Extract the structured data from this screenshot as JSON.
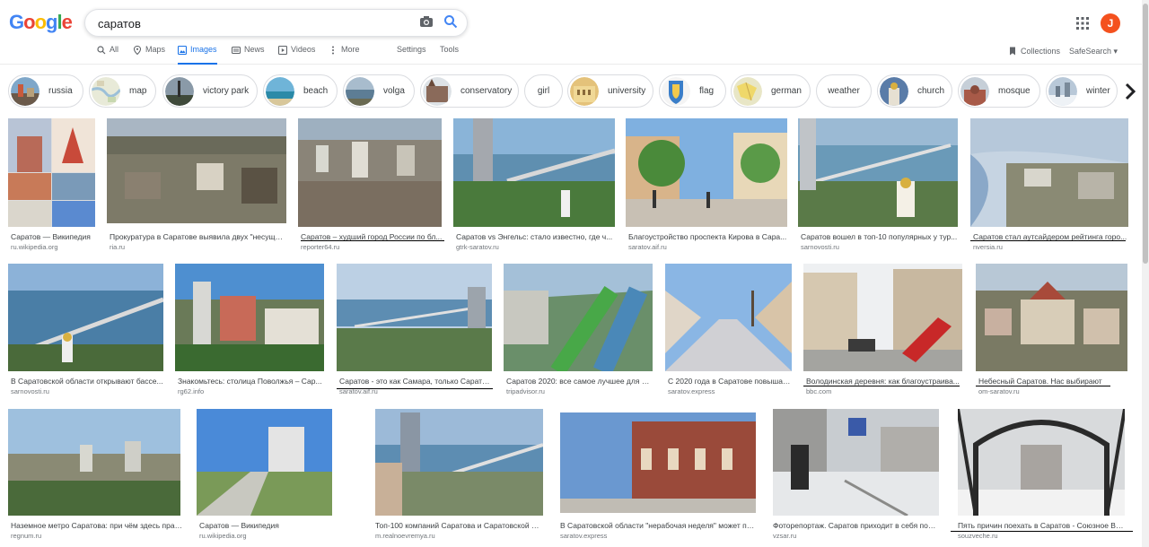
{
  "search": {
    "query": "саратов"
  },
  "user": {
    "initial": "J"
  },
  "tabs": [
    {
      "label": "All"
    },
    {
      "label": "Maps"
    },
    {
      "label": "Images"
    },
    {
      "label": "News"
    },
    {
      "label": "Videos"
    },
    {
      "label": "More"
    },
    {
      "label": "Settings"
    },
    {
      "label": "Tools"
    }
  ],
  "toolbar": {
    "collections": "Collections",
    "safesearch": "SafeSearch ▾"
  },
  "chips": [
    {
      "label": "russia"
    },
    {
      "label": "map"
    },
    {
      "label": "victory park"
    },
    {
      "label": "beach"
    },
    {
      "label": "volga"
    },
    {
      "label": "conservatory"
    },
    {
      "label": "girl"
    },
    {
      "label": "university"
    },
    {
      "label": "flag"
    },
    {
      "label": "german"
    },
    {
      "label": "weather"
    },
    {
      "label": "church"
    },
    {
      "label": "mosque"
    },
    {
      "label": "winter"
    }
  ],
  "results": [
    {
      "caption": "Саратов — Википедия",
      "source": "ru.wikipedia.org"
    },
    {
      "caption": "Прокуратура в Саратове выявила двух \"несуще...",
      "source": "ria.ru"
    },
    {
      "caption": "Саратов – худший город России по бл...",
      "source": "reporter64.ru"
    },
    {
      "caption": "Саратов vs Энгельс: стало известно, где ч...",
      "source": "gtrk-saratov.ru"
    },
    {
      "caption": "Благоустройство проспекта Кирова в Сара...",
      "source": "saratov.aif.ru"
    },
    {
      "caption": "Саратов вошел в топ-10 популярных у тур...",
      "source": "sarnovosti.ru"
    },
    {
      "caption": "Саратов стал аутсайдером рейтинга горо...",
      "source": "nversia.ru"
    },
    {
      "caption": "В Саратовской области открывают бассе...",
      "source": "sarnovosti.ru"
    },
    {
      "caption": "Знакомьтесь: столица Поволжья – Сар...",
      "source": "rg62.info"
    },
    {
      "caption": "Саратов - это как Самара, только Сарато...",
      "source": "saratov.aif.ru"
    },
    {
      "caption": "Саратов 2020: все самое лучшее для ту...",
      "source": "tripadvisor.ru"
    },
    {
      "caption": "С 2020 года в Саратове повышае...",
      "source": "saratov.express"
    },
    {
      "caption": "Володинская деревня: как благоустраива...",
      "source": "bbc.com"
    },
    {
      "caption": "Небесный Саратов. Нас выбирают",
      "source": "om-saratov.ru"
    },
    {
      "caption": "Наземное метро Саратова: при чём здесь прав...",
      "source": "regnum.ru"
    },
    {
      "caption": "Саратов — Википедия",
      "source": "ru.wikipedia.org"
    },
    {
      "caption": "Топ-100 компаний Саратова и Саратовской об...",
      "source": "m.realnoevremya.ru"
    },
    {
      "caption": "В Саратовской области \"нерабочая неделя\" может пр...",
      "source": "saratov.express"
    },
    {
      "caption": "Фоторепортаж. Саратов приходит в себя посл...",
      "source": "vzsar.ru"
    },
    {
      "caption": "Пять причин поехать в Саратов - Союзное Вече",
      "source": "souzveche.ru"
    }
  ]
}
